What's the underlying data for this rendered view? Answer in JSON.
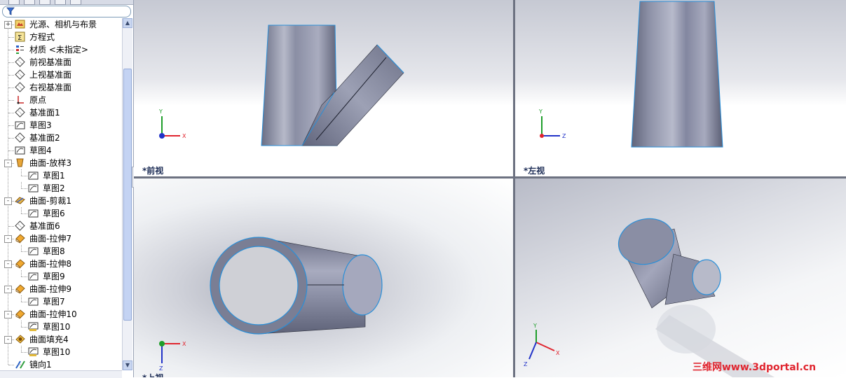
{
  "feature_tree": {
    "items": [
      {
        "label": "光源、相机与布景",
        "icon": "lights-cameras-scene-icon",
        "expander": "+"
      },
      {
        "label": "方程式",
        "icon": "equations-icon",
        "expander": ""
      },
      {
        "label": "材质 <未指定>",
        "icon": "material-icon",
        "expander": ""
      },
      {
        "label": "前视基准面",
        "icon": "plane-icon",
        "expander": ""
      },
      {
        "label": "上视基准面",
        "icon": "plane-icon",
        "expander": ""
      },
      {
        "label": "右视基准面",
        "icon": "plane-icon",
        "expander": ""
      },
      {
        "label": "原点",
        "icon": "origin-icon",
        "expander": ""
      },
      {
        "label": "基准面1",
        "icon": "plane-icon",
        "expander": ""
      },
      {
        "label": "草图3",
        "icon": "sketch-icon",
        "expander": ""
      },
      {
        "label": "基准面2",
        "icon": "plane-icon",
        "expander": ""
      },
      {
        "label": "草图4",
        "icon": "sketch-icon",
        "expander": ""
      },
      {
        "label": "曲面-放样3",
        "icon": "surface-loft-icon",
        "expander": "-"
      },
      {
        "label": "草图1",
        "icon": "sketch-icon",
        "expander": "",
        "child": true
      },
      {
        "label": "草图2",
        "icon": "sketch-icon",
        "expander": "",
        "child": true
      },
      {
        "label": "曲面-剪裁1",
        "icon": "surface-trim-icon",
        "expander": "-"
      },
      {
        "label": "草图6",
        "icon": "sketch-icon",
        "expander": "",
        "child": true
      },
      {
        "label": "基准面6",
        "icon": "plane-icon",
        "expander": ""
      },
      {
        "label": "曲面-拉伸7",
        "icon": "surface-extrude-icon",
        "expander": "-"
      },
      {
        "label": "草图8",
        "icon": "sketch-icon",
        "expander": "",
        "child": true
      },
      {
        "label": "曲面-拉伸8",
        "icon": "surface-extrude-icon",
        "expander": "-"
      },
      {
        "label": "草图9",
        "icon": "sketch-icon",
        "expander": "",
        "child": true
      },
      {
        "label": "曲面-拉伸9",
        "icon": "surface-extrude-icon",
        "expander": "-"
      },
      {
        "label": "草图7",
        "icon": "sketch-icon",
        "expander": "",
        "child": true
      },
      {
        "label": "曲面-拉伸10",
        "icon": "surface-extrude-icon",
        "expander": "-"
      },
      {
        "label": "草图10",
        "icon": "sketch-3d-icon",
        "expander": "",
        "child": true
      },
      {
        "label": "曲面填充4",
        "icon": "surface-fill-icon",
        "expander": "-"
      },
      {
        "label": "草图10",
        "icon": "sketch-3d-icon",
        "expander": "",
        "child": true
      },
      {
        "label": "镜向1",
        "icon": "mirror-icon",
        "expander": ""
      }
    ]
  },
  "viewports": {
    "front": {
      "label": "*前视"
    },
    "left": {
      "label": "*左视"
    },
    "top": {
      "label": "*上视"
    },
    "iso": {
      "label": ""
    }
  },
  "axes": {
    "x": "X",
    "y": "Y",
    "z": "Z"
  },
  "watermark": "三维网www.3dportal.cn",
  "colors": {
    "part_body": "#7e8299",
    "part_edge": "#2a8fd8",
    "viewport_bg_top": "#c9ccd6",
    "viewport_bg_bottom": "#ffffff",
    "label_color": "#1c2c55",
    "watermark": "#e0252f",
    "axis_x": "#e0252f",
    "axis_y": "#1e9e2a",
    "axis_z": "#2233c8"
  }
}
